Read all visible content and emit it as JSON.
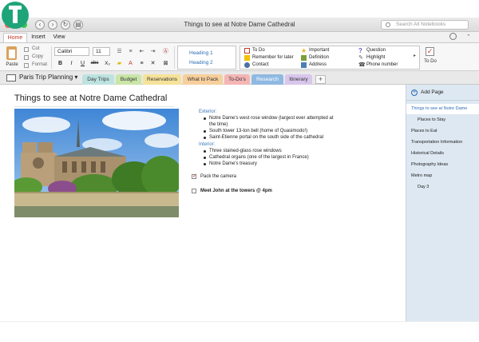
{
  "window": {
    "title": "Things to see at Notre Dame Cathedral",
    "search_placeholder": "Search All Notebooks",
    "traffic_colors": [
      "#fc605c",
      "#fdbc40",
      "#34c84a"
    ]
  },
  "ribbon_tabs": [
    {
      "label": "Home",
      "active": true
    },
    {
      "label": "Insert",
      "active": false
    },
    {
      "label": "View",
      "active": false
    }
  ],
  "clipboard": {
    "paste_label": "Paste",
    "cut_label": "Cut",
    "copy_label": "Copy",
    "format_label": "Format"
  },
  "font": {
    "name": "Calibri",
    "size": "11",
    "buttons": [
      "B",
      "I",
      "U",
      "abc",
      "X₂"
    ]
  },
  "styles": {
    "heading1": "Heading 1",
    "heading2": "Heading 2"
  },
  "tags": [
    {
      "label": "To Do",
      "icon": "checkbox-icon",
      "color": "#c0392b"
    },
    {
      "label": "Remember for later",
      "icon": "highlighter-icon",
      "color": "#f2c200"
    },
    {
      "label": "Contact",
      "icon": "contact-icon",
      "color": "#4a6fa5"
    },
    {
      "label": "Important",
      "icon": "star-icon",
      "color": "#f2b01e"
    },
    {
      "label": "Definition",
      "icon": "book-icon",
      "color": "#7a9e3a"
    },
    {
      "label": "Address",
      "icon": "house-icon",
      "color": "#4a7fb5"
    },
    {
      "label": "Question",
      "icon": "question-icon",
      "color": "#6a5acd"
    },
    {
      "label": "Highlight",
      "icon": "pen-icon",
      "color": "#555555"
    },
    {
      "label": "Phone number",
      "icon": "phone-icon",
      "color": "#444444"
    }
  ],
  "todo_button_label": "To Do",
  "notebook": {
    "name": "Paris Trip Planning"
  },
  "sections": [
    {
      "label": "Day Trips",
      "color": "#bde3e0"
    },
    {
      "label": "Budget",
      "color": "#c9e6a8"
    },
    {
      "label": "Reservations",
      "color": "#f6e39a"
    },
    {
      "label": "What to Pack",
      "color": "#f7cf9c"
    },
    {
      "label": "To-Do's",
      "color": "#f4b5b5"
    },
    {
      "label": "Research",
      "color": "#8fb9e2",
      "active": true
    },
    {
      "label": "Itinerary",
      "color": "#d9c6ec"
    }
  ],
  "page": {
    "title": "Things to see at Notre Dame Cathedral",
    "exterior_heading": "Exterior:",
    "exterior_items": [
      "Notre Dame's west rose window (largest ever attempted at",
      "the time)",
      "South tower 13-ton bell (home of Quasimodo!)",
      "Saint-Etienne portal on the south side of the cathedral"
    ],
    "interior_heading": "Interior:",
    "interior_items": [
      "Three stained-glass rose windows",
      "Cathedral organs (one of the largest in France)",
      "Notre Dame's treasury"
    ],
    "todos": [
      {
        "label": "Pack the camera",
        "checked": true
      },
      {
        "label": "Meet John at the towers @ 4pm",
        "checked": false
      }
    ]
  },
  "pages_pane": {
    "add_page_label": "Add Page",
    "items": [
      {
        "label": "Things to see at Notre Dame",
        "indent": 0,
        "selected": true
      },
      {
        "label": "Places to Stay",
        "indent": 1,
        "selected": false
      },
      {
        "label": "Places to Eat",
        "indent": 0,
        "selected": false
      },
      {
        "label": "Transportation Information",
        "indent": 0,
        "selected": false
      },
      {
        "label": "Historical Details",
        "indent": 0,
        "selected": false
      },
      {
        "label": "Photography Ideas",
        "indent": 0,
        "selected": false
      },
      {
        "label": "Metro map",
        "indent": 0,
        "selected": false
      },
      {
        "label": "Day 3",
        "indent": 1,
        "selected": false
      }
    ]
  }
}
